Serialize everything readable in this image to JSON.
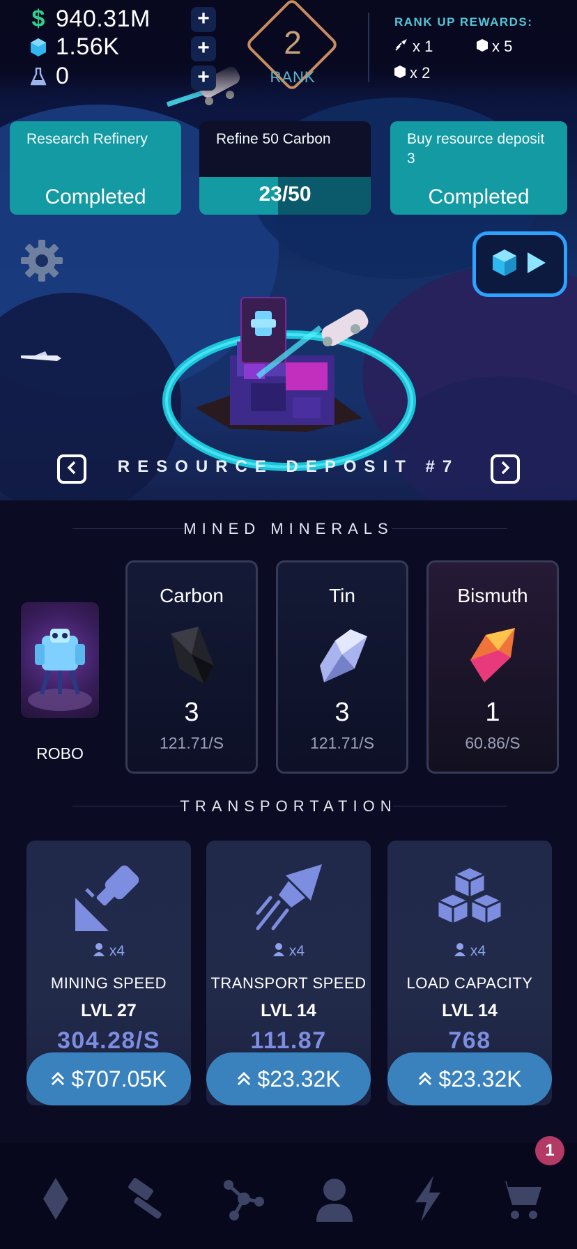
{
  "resources": {
    "cash": "940.31M",
    "crystals": "1.56K",
    "research": "0"
  },
  "rank": {
    "number": "2",
    "label": "RANK"
  },
  "rank_rewards": {
    "title": "RANK UP REWARDS:",
    "items": [
      "x 1",
      "x 5",
      "x 2"
    ]
  },
  "quests": [
    {
      "title": "Research Refinery",
      "status": "Completed"
    },
    {
      "title": "Refine 50 Carbon",
      "progress_text": "23/50",
      "progress_fraction": 0.46
    },
    {
      "title": "Buy resource deposit 3",
      "status": "Completed"
    }
  ],
  "deposit": {
    "label": "RESOURCE DEPOSIT #7"
  },
  "mined_minerals": {
    "title": "MINED MINERALS",
    "robo_label": "ROBO",
    "items": [
      {
        "name": "Carbon",
        "count": "3",
        "rate": "121.71/S",
        "color": "#1c1c22"
      },
      {
        "name": "Tin",
        "count": "3",
        "rate": "121.71/S",
        "color": "#a9b3ee"
      },
      {
        "name": "Bismuth",
        "count": "1",
        "rate": "60.86/S",
        "color": "#f0743a"
      }
    ]
  },
  "transportation": {
    "title": "TRANSPORTATION",
    "items": [
      {
        "icon": "drill-icon",
        "multiplier": "x4",
        "name": "MINING SPEED",
        "level": "LVL 27",
        "value": "304.28/S",
        "price": "$707.05K"
      },
      {
        "icon": "rocket-icon",
        "multiplier": "x4",
        "name": "TRANSPORT SPEED",
        "level": "LVL 14",
        "value": "111.87",
        "price": "$23.32K"
      },
      {
        "icon": "cubes-icon",
        "multiplier": "x4",
        "name": "LOAD CAPACITY",
        "level": "LVL 14",
        "value": "768",
        "price": "$23.32K"
      }
    ]
  },
  "nav": {
    "items": [
      "gem-icon",
      "hammer-icon",
      "network-icon",
      "user-icon",
      "bolt-icon",
      "cart-icon"
    ],
    "cart_badge": "1"
  },
  "colors": {
    "teal": "#139aa3",
    "upgrade_button": "#3a82bd",
    "boost_border": "#2ea2ff"
  }
}
